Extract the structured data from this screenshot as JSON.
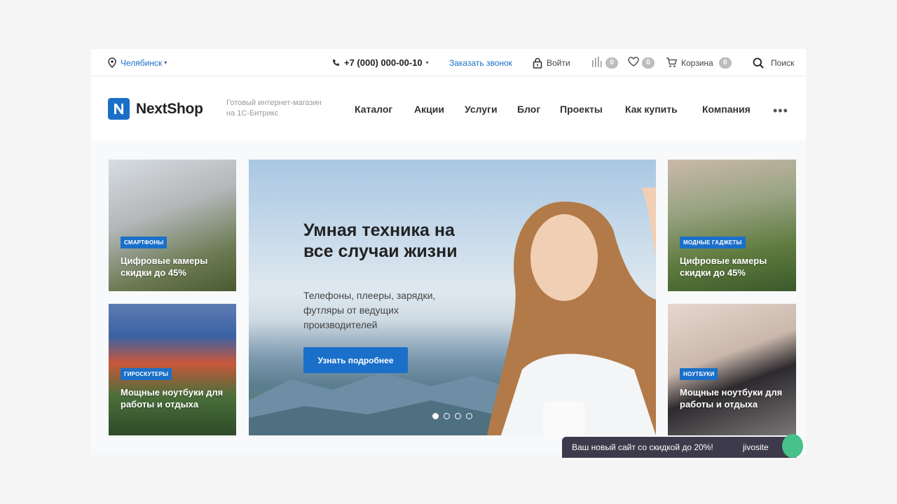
{
  "topbar": {
    "city": "Челябинск",
    "phone": "+7 (000) 000-00-10",
    "callback": "Заказать звонок",
    "login": "Войти",
    "compare_count": "0",
    "favorites_count": "0",
    "cart_label": "Корзина",
    "cart_count": "0",
    "search_label": "Поиск"
  },
  "header": {
    "logo": "NextShop",
    "tagline": "Готовый интернет-магазин на 1С-Битрикс",
    "nav": [
      "Каталог",
      "Акции",
      "Услуги",
      "Блог",
      "Проекты",
      "Как купить",
      "Компания"
    ]
  },
  "tiles": [
    {
      "tag": "СМАРТФОНЫ",
      "title": "Цифровые камеры скидки до 45%"
    },
    {
      "tag": "ГИРОСКУТЕРЫ",
      "title": "Мощные ноутбуки для работы и отдыха"
    },
    {
      "tag": "МОДНЫЕ ГАДЖЕТЫ",
      "title": "Цифровые камеры скидки до 45%"
    },
    {
      "tag": "НОУТБУКИ",
      "title": "Мощные ноутбуки для работы и отдыха"
    }
  ],
  "slider": {
    "title": "Умная техника на все случаи жизни",
    "text": "Телефоны, плееры, зарядки, футляры от ведущих производителей",
    "button": "Узнать подробнее",
    "active_index": 0,
    "slide_count": 4
  },
  "jivo": {
    "message": "Ваш новый сайт со скидкой до 20%!",
    "brand": "jivosite"
  },
  "colors": {
    "accent": "#1a6fc9",
    "badge": "#bdbdbd",
    "jivo": "#3d3a4b"
  }
}
